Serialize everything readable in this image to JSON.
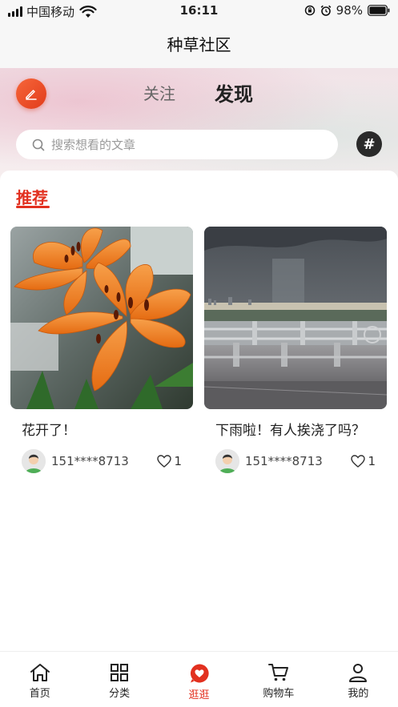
{
  "status_bar": {
    "carrier": "中国移动",
    "time": "16:11",
    "battery": "98%"
  },
  "nav": {
    "title": "种草社区"
  },
  "tabs": [
    {
      "label": "关注",
      "active": false
    },
    {
      "label": "发现",
      "active": true
    }
  ],
  "search": {
    "placeholder": "搜索想看的文章"
  },
  "section": {
    "title": "推荐"
  },
  "posts": [
    {
      "title": "花开了！",
      "author": "151****8713",
      "likes": "1",
      "image": "orange-lily-photo"
    },
    {
      "title": "下雨啦！有人挨浇了吗？",
      "author": "151****8713",
      "likes": "1",
      "image": "rain-over-city-photo"
    }
  ],
  "bottom_nav": [
    {
      "label": "首页",
      "icon": "home-icon",
      "active": false
    },
    {
      "label": "分类",
      "icon": "grid-icon",
      "active": false
    },
    {
      "label": "逛逛",
      "icon": "heart-bubble-icon",
      "active": true
    },
    {
      "label": "购物车",
      "icon": "cart-icon",
      "active": false
    },
    {
      "label": "我的",
      "icon": "user-icon",
      "active": false
    }
  ],
  "colors": {
    "accent": "#e2301f",
    "edit_button": "#f0522c"
  }
}
